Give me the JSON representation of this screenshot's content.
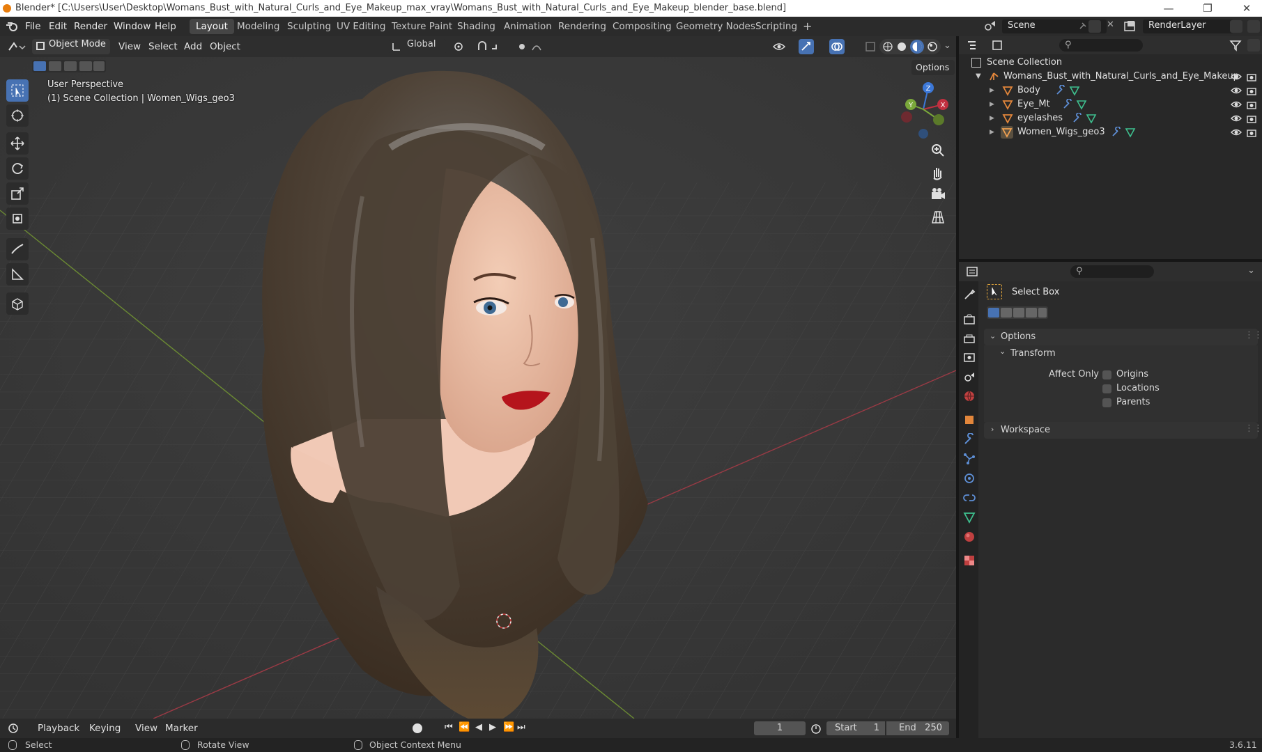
{
  "titlebar": {
    "title": "Blender* [C:\\Users\\User\\Desktop\\Womans_Bust_with_Natural_Curls_and_Eye_Makeup_max_vray\\Womans_Bust_with_Natural_Curls_and_Eye_Makeup_blender_base.blend]"
  },
  "menu": {
    "file": "File",
    "edit": "Edit",
    "render": "Render",
    "window": "Window",
    "help": "Help"
  },
  "workspaces": [
    "Layout",
    "Modeling",
    "Sculpting",
    "UV Editing",
    "Texture Paint",
    "Shading",
    "Animation",
    "Rendering",
    "Compositing",
    "Geometry Nodes",
    "Scripting"
  ],
  "scene": {
    "name": "Scene",
    "render_layer": "RenderLayer"
  },
  "viewport_header": {
    "mode": "Object Mode",
    "view": "View",
    "select": "Select",
    "add": "Add",
    "object": "Object",
    "orientation": "Global",
    "options": "Options"
  },
  "viewport": {
    "perspective_label": "User Perspective",
    "collection_label": "(1) Scene Collection | Women_Wigs_geo3",
    "axis_x": "X",
    "axis_y": "Y",
    "axis_z": "Z"
  },
  "outliner": {
    "root": "Scene Collection",
    "collection": "Womans_Bust_with_Natural_Curls_and_Eye_Makeup",
    "objects": [
      "Body",
      "Eye_Mt",
      "eyelashes",
      "Women_Wigs_geo3"
    ]
  },
  "properties": {
    "tool_name": "Select Box",
    "options_panel": "Options",
    "transform_sub": "Transform",
    "affect_only": "Affect Only",
    "checkboxes": [
      "Origins",
      "Locations",
      "Parents"
    ],
    "workspace_panel": "Workspace"
  },
  "timeline": {
    "playback": "Playback",
    "keying": "Keying",
    "view": "View",
    "marker": "Marker",
    "current_frame": "1",
    "start_label": "Start",
    "start": "1",
    "end_label": "End",
    "end": "250"
  },
  "statusbar": {
    "select": "Select",
    "rotate": "Rotate View",
    "context": "Object Context Menu",
    "version": "3.6.11"
  }
}
